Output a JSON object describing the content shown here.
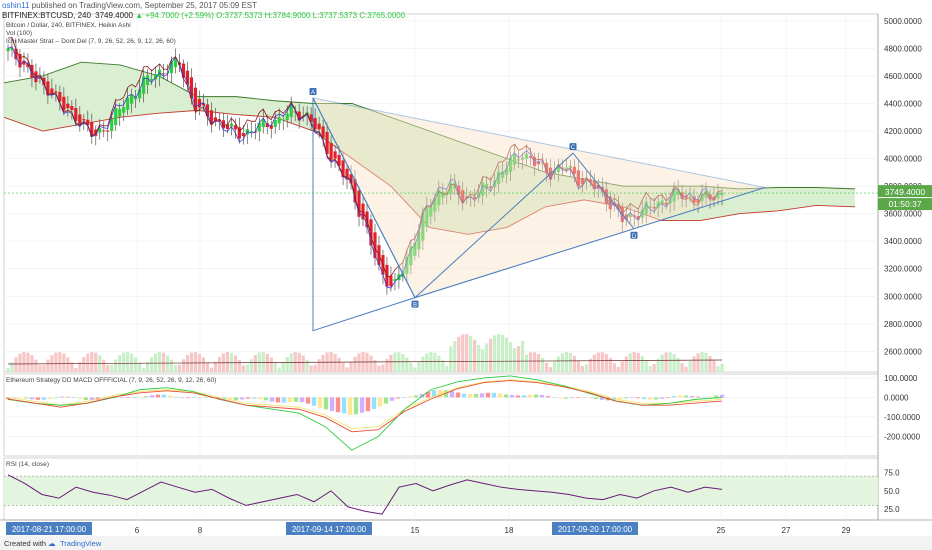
{
  "header": {
    "author": "oshin11",
    "published": "published on TradingView.com, September 25, 2017 05:09 EST",
    "symbol": "BITFINEX:BTCUSD, 240",
    "last": "3749.4000",
    "change": "+94.7000 (+2.59%)",
    "ohlc": "O:3737.5373 H:3784.9000 L:3737.5373 C:3765.0000"
  },
  "legend": {
    "title": "Bitcoin / Dollar, 240, BITFINEX, Heikin Ashi",
    "vol": "Vol (100)",
    "ichimoku": "Ichi Master Strat -- Dont Del (7, 9, 26, 52, 26, 9, 12, 26, 60)",
    "macd": "Ethereum Strategy DD MACD OFFFICIAL (7, 9, 26, 52, 26, 9, 12, 26, 60)",
    "rsi": "RSI (14, close)"
  },
  "badges": {
    "price": "3749.4000",
    "countdown": "01:50:37"
  },
  "footer": {
    "created": "Created with",
    "brand": "TradingView"
  },
  "colors": {
    "up": "#2ecc40",
    "down": "#e0202a",
    "pattern": "#4a7fc1",
    "cloud_red": "#f6c6c6",
    "cloud_green": "#cde8c3",
    "rsi_line": "#6a1b7a",
    "macd_fast": "#2ecc40",
    "macd_slow": "#e74c3c"
  },
  "chart_data": [
    {
      "type": "candlestick",
      "title": "Bitcoin / Dollar, 240, BITFINEX, Heikin Ashi",
      "ylim": [
        2450,
        5050
      ],
      "y_ticks": [
        5000,
        4800,
        4600,
        4400,
        4200,
        4000,
        3800,
        3600,
        3400,
        3200,
        3000,
        2800,
        2600
      ],
      "y_tick_labels": [
        "5000.0000",
        "4800.0000",
        "4600.0000",
        "4400.0000",
        "4200.0000",
        "4000.0000",
        "3800.0000",
        "3600.0000",
        "3400.0000",
        "3200.0000",
        "3000.0000",
        "2800.0000",
        "2600.0000"
      ],
      "x_ticks": [
        "6",
        "8",
        "15",
        "18",
        "25",
        "27",
        "29"
      ],
      "x_highlight_labels": [
        "2017-08-21 17:00:00",
        "2017-09-14 17:00:00",
        "2017-09-20 17:00:00"
      ],
      "price_close_path": [
        4780,
        4700,
        4550,
        4500,
        4350,
        4300,
        4150,
        4250,
        4380,
        4500,
        4600,
        4650,
        4700,
        4400,
        4300,
        4250,
        4180,
        4200,
        4250,
        4280,
        4350,
        4300,
        4150,
        3950,
        3800,
        3500,
        3200,
        3050,
        3300,
        3550,
        3750,
        3800,
        3700,
        3750,
        3850,
        3950,
        4050,
        3950,
        3900,
        3950,
        3850,
        3800,
        3700,
        3550,
        3600,
        3650,
        3700,
        3750,
        3700,
        3720,
        3750
      ],
      "ichimoku_cloud": {
        "upper": [
          4550,
          4600,
          4700,
          4680,
          4600,
          4450,
          4450,
          4420,
          4400,
          4400,
          4300,
          4200,
          4100,
          4000,
          3900,
          3850,
          3800,
          3800,
          3800,
          3780,
          3790,
          3790,
          3780
        ],
        "lower": [
          4300,
          4200,
          4250,
          4300,
          4330,
          4350,
          4320,
          4300,
          4200,
          4000,
          3800,
          3500,
          3450,
          3500,
          3650,
          3700,
          3650,
          3550,
          3550,
          3600,
          3620,
          3660,
          3650
        ]
      },
      "patterns": [
        {
          "name": "A",
          "price": 4440
        },
        {
          "name": "B",
          "price": 2990
        },
        {
          "name": "C",
          "price": 4040
        },
        {
          "name": "D",
          "price": 3490
        }
      ]
    },
    {
      "type": "bar",
      "title": "Ethereum Strategy DD MACD OFFFICIAL (7, 9, 26, 52, 26, 9, 12, 26, 60)",
      "ylim": [
        -300,
        120
      ],
      "y_ticks": [
        100,
        0,
        -100,
        -200
      ],
      "y_tick_labels": [
        "100.0000",
        "0.0000",
        "-100.0000",
        "-200.0000"
      ],
      "macd_fast": [
        -10,
        -30,
        -40,
        -30,
        0,
        40,
        50,
        30,
        -10,
        -40,
        -60,
        -80,
        -150,
        -270,
        -200,
        -60,
        40,
        80,
        100,
        110,
        90,
        60,
        20,
        -20,
        -40,
        -30,
        -10,
        0
      ],
      "macd_slow": [
        0,
        -20,
        -40,
        -20,
        10,
        30,
        40,
        30,
        0,
        -30,
        -40,
        -50,
        -90,
        -160,
        -150,
        -60,
        0,
        50,
        80,
        90,
        80,
        60,
        30,
        -10,
        -30,
        -30,
        -20,
        -10
      ]
    },
    {
      "type": "line",
      "title": "RSI (14, close)",
      "ylim": [
        10,
        95
      ],
      "y_ticks": [
        75,
        50,
        25
      ],
      "y_tick_labels": [
        "75.0",
        "50.0",
        "25.0"
      ],
      "values": [
        72,
        60,
        45,
        40,
        55,
        48,
        44,
        38,
        50,
        62,
        55,
        48,
        52,
        40,
        30,
        35,
        40,
        45,
        35,
        50,
        28,
        22,
        18,
        55,
        60,
        50,
        58,
        65,
        60,
        55,
        52,
        50,
        48,
        45,
        40,
        38,
        45,
        40,
        50,
        55,
        48,
        55,
        52
      ]
    }
  ]
}
